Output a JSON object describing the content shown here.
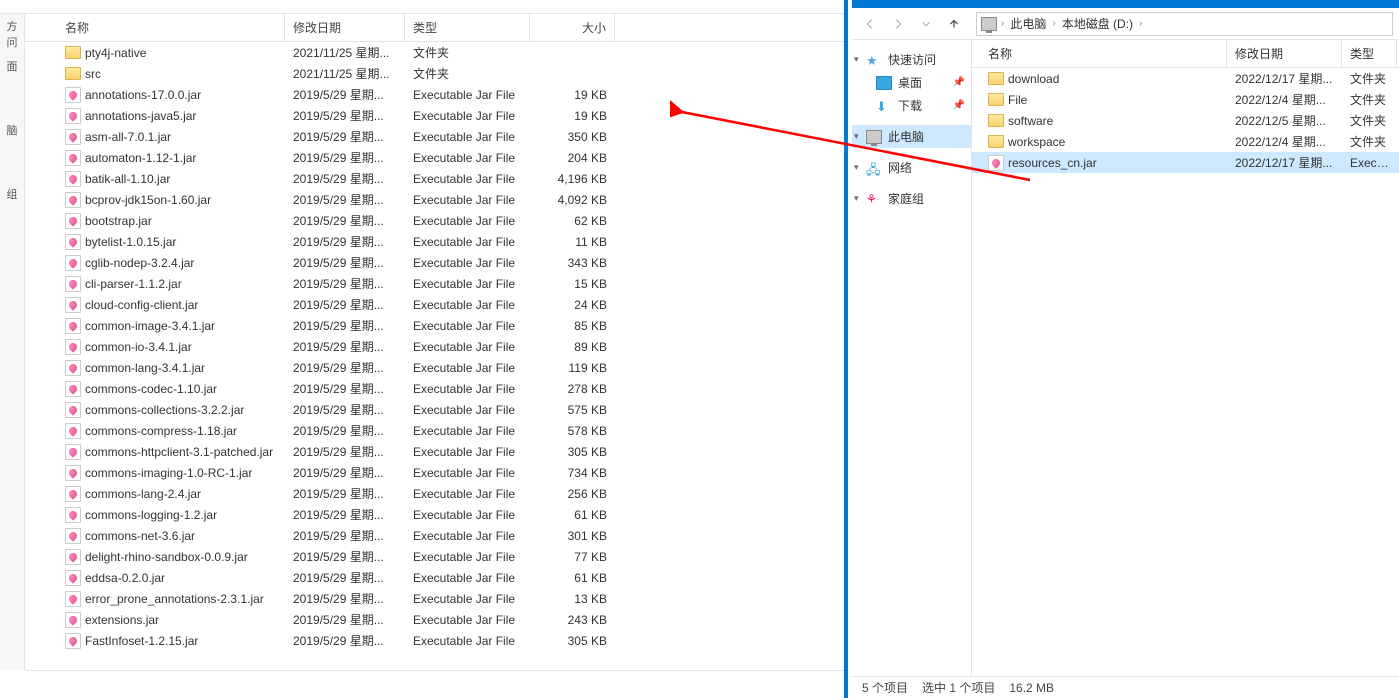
{
  "left": {
    "quick": [
      "方问",
      "面",
      "脑",
      "组"
    ],
    "columns": {
      "name": "名称",
      "date": "修改日期",
      "type": "类型",
      "size": "大小"
    },
    "folder_type": "文件夹",
    "jar_type": "Executable Jar File",
    "folders": [
      {
        "name": "pty4j-native",
        "date": "2021/11/25 星期..."
      },
      {
        "name": "src",
        "date": "2021/11/25 星期..."
      }
    ],
    "files": [
      {
        "name": "annotations-17.0.0.jar",
        "date": "2019/5/29 星期...",
        "size": "19 KB"
      },
      {
        "name": "annotations-java5.jar",
        "date": "2019/5/29 星期...",
        "size": "19 KB"
      },
      {
        "name": "asm-all-7.0.1.jar",
        "date": "2019/5/29 星期...",
        "size": "350 KB"
      },
      {
        "name": "automaton-1.12-1.jar",
        "date": "2019/5/29 星期...",
        "size": "204 KB"
      },
      {
        "name": "batik-all-1.10.jar",
        "date": "2019/5/29 星期...",
        "size": "4,196 KB"
      },
      {
        "name": "bcprov-jdk15on-1.60.jar",
        "date": "2019/5/29 星期...",
        "size": "4,092 KB"
      },
      {
        "name": "bootstrap.jar",
        "date": "2019/5/29 星期...",
        "size": "62 KB"
      },
      {
        "name": "bytelist-1.0.15.jar",
        "date": "2019/5/29 星期...",
        "size": "11 KB"
      },
      {
        "name": "cglib-nodep-3.2.4.jar",
        "date": "2019/5/29 星期...",
        "size": "343 KB"
      },
      {
        "name": "cli-parser-1.1.2.jar",
        "date": "2019/5/29 星期...",
        "size": "15 KB"
      },
      {
        "name": "cloud-config-client.jar",
        "date": "2019/5/29 星期...",
        "size": "24 KB"
      },
      {
        "name": "common-image-3.4.1.jar",
        "date": "2019/5/29 星期...",
        "size": "85 KB"
      },
      {
        "name": "common-io-3.4.1.jar",
        "date": "2019/5/29 星期...",
        "size": "89 KB"
      },
      {
        "name": "common-lang-3.4.1.jar",
        "date": "2019/5/29 星期...",
        "size": "119 KB"
      },
      {
        "name": "commons-codec-1.10.jar",
        "date": "2019/5/29 星期...",
        "size": "278 KB"
      },
      {
        "name": "commons-collections-3.2.2.jar",
        "date": "2019/5/29 星期...",
        "size": "575 KB"
      },
      {
        "name": "commons-compress-1.18.jar",
        "date": "2019/5/29 星期...",
        "size": "578 KB"
      },
      {
        "name": "commons-httpclient-3.1-patched.jar",
        "date": "2019/5/29 星期...",
        "size": "305 KB"
      },
      {
        "name": "commons-imaging-1.0-RC-1.jar",
        "date": "2019/5/29 星期...",
        "size": "734 KB"
      },
      {
        "name": "commons-lang-2.4.jar",
        "date": "2019/5/29 星期...",
        "size": "256 KB"
      },
      {
        "name": "commons-logging-1.2.jar",
        "date": "2019/5/29 星期...",
        "size": "61 KB"
      },
      {
        "name": "commons-net-3.6.jar",
        "date": "2019/5/29 星期...",
        "size": "301 KB"
      },
      {
        "name": "delight-rhino-sandbox-0.0.9.jar",
        "date": "2019/5/29 星期...",
        "size": "77 KB"
      },
      {
        "name": "eddsa-0.2.0.jar",
        "date": "2019/5/29 星期...",
        "size": "61 KB"
      },
      {
        "name": "error_prone_annotations-2.3.1.jar",
        "date": "2019/5/29 星期...",
        "size": "13 KB"
      },
      {
        "name": "extensions.jar",
        "date": "2019/5/29 星期...",
        "size": "243 KB"
      },
      {
        "name": "FastInfoset-1.2.15.jar",
        "date": "2019/5/29 星期...",
        "size": "305 KB"
      }
    ]
  },
  "right": {
    "breadcrumb": [
      "此电脑",
      "本地磁盘 (D:)"
    ],
    "columns": {
      "name": "名称",
      "date": "修改日期",
      "type": "类型"
    },
    "nav": {
      "quick": "快速访问",
      "desktop": "桌面",
      "downloads": "下载",
      "pc": "此电脑",
      "network": "网络",
      "homegroup": "家庭组"
    },
    "folder_type": "文件夹",
    "jar_type": "Executa",
    "folders": [
      {
        "name": "download",
        "date": "2022/12/17 星期..."
      },
      {
        "name": "File",
        "date": "2022/12/4 星期..."
      },
      {
        "name": "software",
        "date": "2022/12/5 星期..."
      },
      {
        "name": "workspace",
        "date": "2022/12/4 星期..."
      }
    ],
    "files": [
      {
        "name": "resources_cn.jar",
        "date": "2022/12/17 星期..."
      }
    ],
    "status": {
      "count": "5 个项目",
      "selected": "选中 1 个项目",
      "size": "16.2 MB"
    }
  }
}
